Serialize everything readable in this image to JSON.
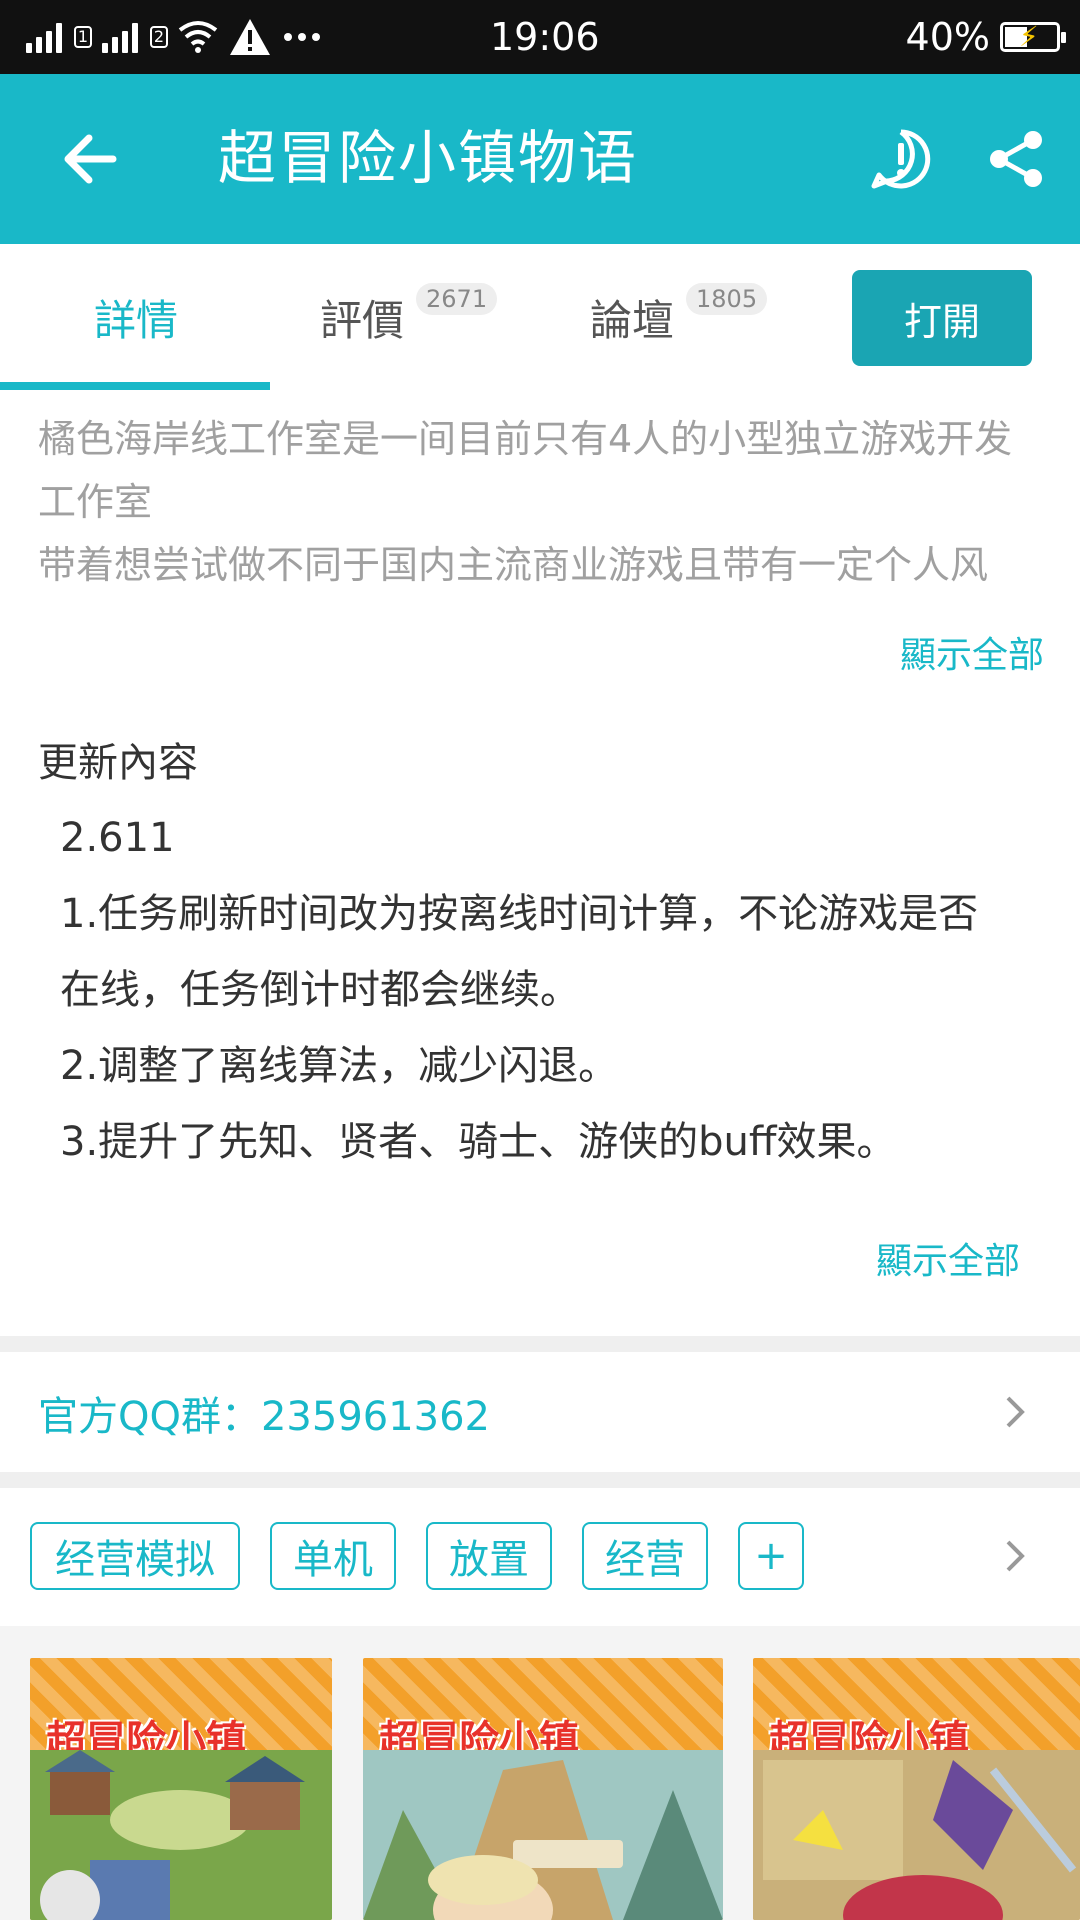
{
  "status_bar": {
    "sim1": "1",
    "sim2": "2",
    "time": "19:06",
    "battery": "40%",
    "battery_level": 0.4
  },
  "app_bar": {
    "title": "超冒险小镇物语",
    "back_icon": "arrow-left-icon",
    "report_icon": "exclamation-circle-icon",
    "share_icon": "share-icon"
  },
  "tabs": [
    {
      "label": "詳情",
      "count": ""
    },
    {
      "label": "評價",
      "count": "2671"
    },
    {
      "label": "論壇",
      "count": "1805"
    }
  ],
  "open_button": "打開",
  "description": {
    "lines": [
      "橘色海岸线工作室是一间目前只有4人的小型独立游戏开发",
      "工作室",
      "带着想尝试做不同于国内主流商业游戏且带有一定个人风"
    ],
    "show_all": "顯示全部"
  },
  "update": {
    "title": "更新內容",
    "lines": [
      "2.611",
      "1.任务刷新时间改为按离线时间计算，不论游戏是否",
      "在线，任务倒计时都会继续。",
      "2.调整了离线算法，减少闪退。",
      "3.提升了先知、贤者、骑士、游侠的buff效果。"
    ],
    "show_all": "顯示全部"
  },
  "qq_group": "官方QQ群：235961362",
  "tags": [
    "经营模拟",
    "单机",
    "放置",
    "经营",
    "+"
  ],
  "screenshots": {
    "logo_text": "超冒险小镇"
  },
  "colors": {
    "accent": "#19b8c8",
    "open_button": "#1aa5b3",
    "status_bar": "#111111"
  }
}
